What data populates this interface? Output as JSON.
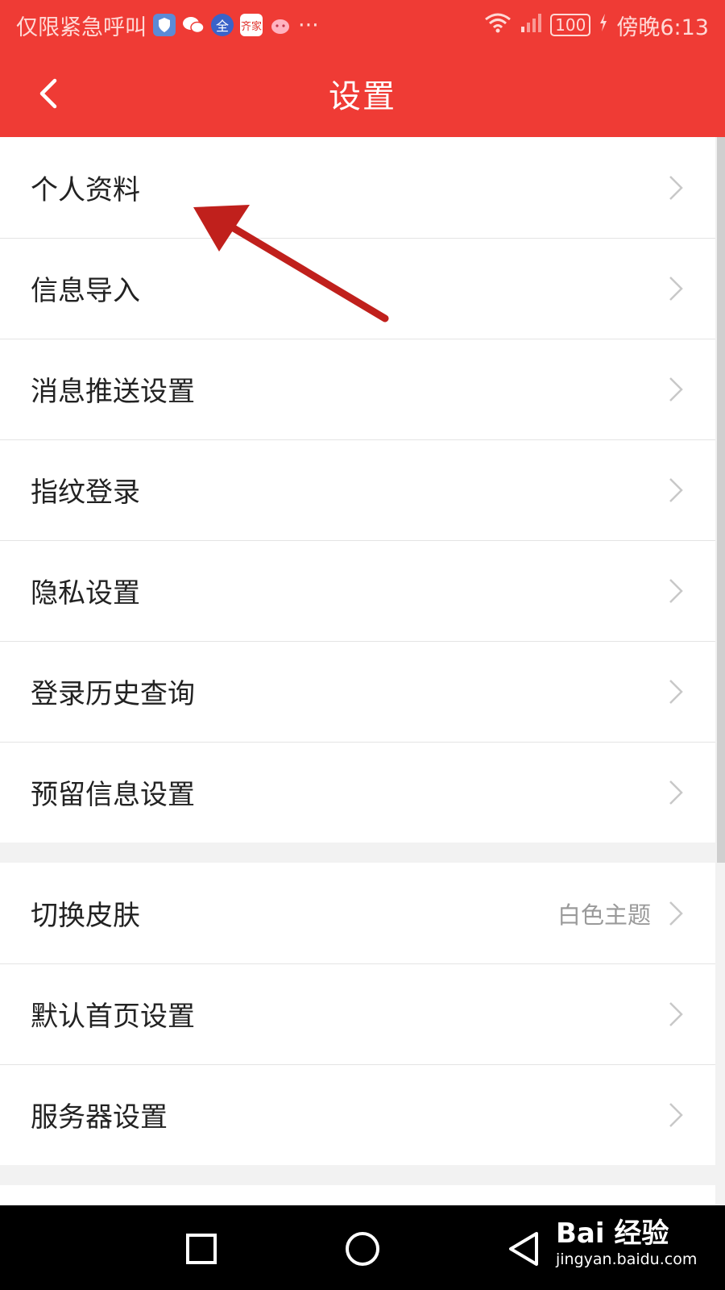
{
  "status_bar": {
    "carrier_text": "仅限紧急呼叫",
    "notification_icons": [
      "shield-icon",
      "wechat-icon",
      "quan-app-icon",
      "qijia-app-icon",
      "pig-app-icon"
    ],
    "more": "···",
    "battery": "100",
    "time": "傍晚6:13"
  },
  "header": {
    "title": "设置"
  },
  "settings_group_1": [
    {
      "label": "个人资料"
    },
    {
      "label": "信息导入"
    },
    {
      "label": "消息推送设置"
    },
    {
      "label": "指纹登录"
    },
    {
      "label": "隐私设置"
    },
    {
      "label": "登录历史查询"
    },
    {
      "label": "预留信息设置"
    }
  ],
  "settings_group_2": [
    {
      "label": "切换皮肤",
      "value": "白色主题"
    },
    {
      "label": "默认首页设置"
    },
    {
      "label": "服务器设置"
    }
  ],
  "watermark": {
    "logo": "Bai 经验",
    "url": "jingyan.baidu.com"
  },
  "colors": {
    "brand_red": "#ef3b35",
    "annotation_arrow": "#c0201c"
  }
}
